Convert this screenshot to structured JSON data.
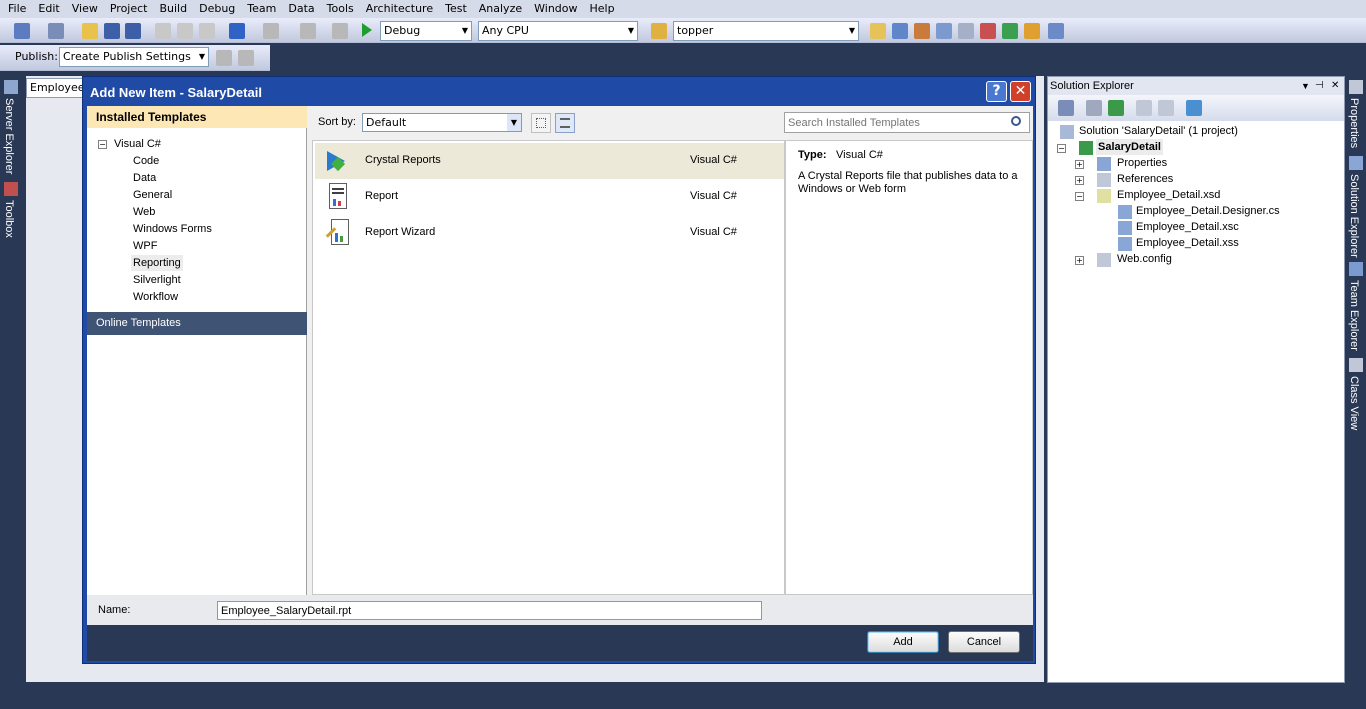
{
  "menu": [
    "File",
    "Edit",
    "View",
    "Project",
    "Build",
    "Debug",
    "Team",
    "Data",
    "Tools",
    "Architecture",
    "Test",
    "Analyze",
    "Window",
    "Help"
  ],
  "toolbar": {
    "config": "Debug",
    "platform": "Any CPU",
    "find": "topper",
    "publish_label": "Publish:",
    "publish_value": "Create Publish Settings"
  },
  "left_strip": {
    "server_explorer": "Server Explorer",
    "toolbox": "Toolbox"
  },
  "right_strip": {
    "properties": "Properties",
    "solution_explorer": "Solution Explorer",
    "team_explorer": "Team Explorer",
    "class_view": "Class View"
  },
  "doc_tab": "Employee_",
  "dialog": {
    "title": "Add New Item - SalaryDetail",
    "help_glyph": "?",
    "close_glyph": "✕",
    "installed_header": "Installed Templates",
    "tree_root": "Visual C#",
    "tree_items": [
      "Code",
      "Data",
      "General",
      "Web",
      "Windows Forms",
      "WPF",
      "Reporting",
      "Silverlight",
      "Workflow"
    ],
    "online_templates": "Online Templates",
    "sort_label": "Sort by:",
    "sort_value": "Default",
    "search_placeholder": "Search Installed Templates",
    "templates": [
      {
        "name": "Crystal Reports",
        "lang": "Visual C#"
      },
      {
        "name": "Report",
        "lang": "Visual C#"
      },
      {
        "name": "Report Wizard",
        "lang": "Visual C#"
      }
    ],
    "type_label": "Type:",
    "type_value": "Visual C#",
    "description_line1": "A Crystal Reports file that publishes data to a",
    "description_line2": "Windows or Web form",
    "name_label": "Name:",
    "name_value": "Employee_SalaryDetail.rpt",
    "add_button": "Add",
    "cancel_button": "Cancel"
  },
  "solution_explorer": {
    "title": "Solution Explorer",
    "solution": "Solution 'SalaryDetail' (1 project)",
    "project": "SalaryDetail",
    "items": [
      "Properties",
      "References",
      "Employee_Detail.xsd",
      "Employee_Detail.Designer.cs",
      "Employee_Detail.xsc",
      "Employee_Detail.xss",
      "Web.config"
    ]
  },
  "colors": {
    "chrome": "#293955",
    "dialog_frame": "#1f4aa6",
    "installed_header": "#fce7b5",
    "selected_row": "#ece9d8",
    "online_header": "#3f5375"
  }
}
